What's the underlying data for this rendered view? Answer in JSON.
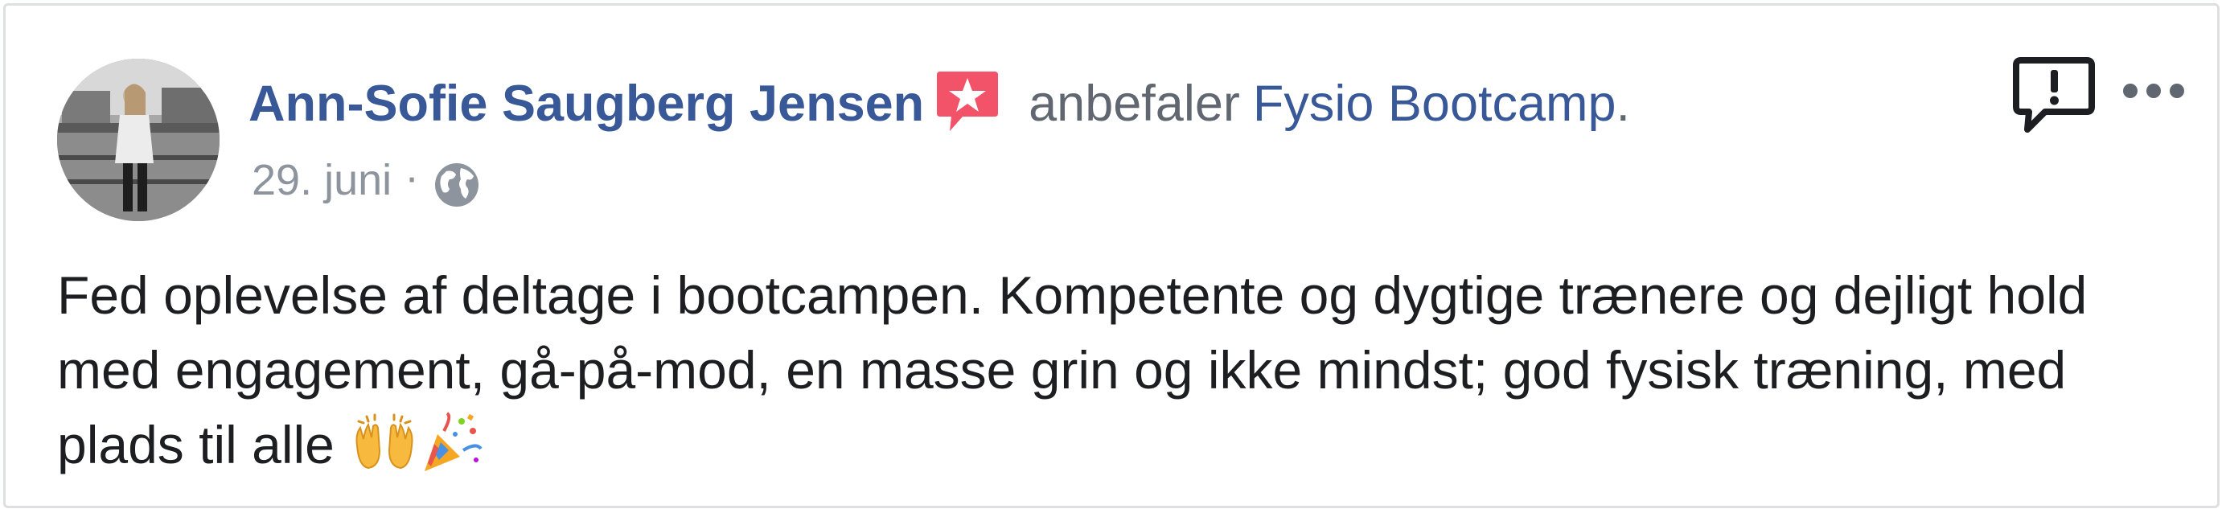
{
  "post": {
    "author_name": "Ann-Sofie Saugberg Jensen",
    "action_text": "anbefaler",
    "page_name": "Fysio Bootcamp",
    "period": ".",
    "date": "29. juni",
    "meta_separator": "·",
    "privacy_icon": "globe-icon",
    "badge_icon": "recommendation-star-icon",
    "badge_color": "#f35369",
    "body_text": "Fed oplevelse af deltage i bootcampen. Kompetente og dygtige trænere og dejligt hold med engagement, gå-på-mod, en masse grin og ikke mindst; god fysisk træning, med plads til alle",
    "emojis": [
      "raising-hands-emoji",
      "party-popper-emoji"
    ]
  },
  "actions": {
    "report_icon": "report-icon",
    "more_icon": "more-options-icon"
  },
  "colors": {
    "link": "#385898",
    "secondary": "#606770",
    "meta": "#8d949e",
    "text": "#1c1e21",
    "border": "#dddfe2"
  }
}
